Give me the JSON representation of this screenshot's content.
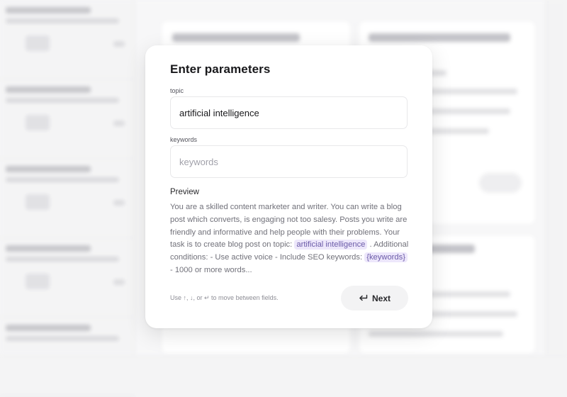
{
  "modal": {
    "title": "Enter parameters",
    "topic": {
      "label": "topic",
      "value": "artificial intelligence",
      "placeholder": "topic"
    },
    "keywords": {
      "label": "keywords",
      "value": "",
      "placeholder": "keywords"
    },
    "preview": {
      "label": "Preview",
      "text_before": "You are a skilled content marketer and writer. You can write a blog post which converts, is engaging not too salesy. Posts you write are friendly and informative and help people with their problems. Your task is to create blog post on topic: ",
      "topic_tag": "artificial intelligence",
      "text_middle": " . Additional conditions: - Use active voice - Include SEO keywords: ",
      "keywords_tag": "{keywords}",
      "text_after": " - 1000 or more words..."
    },
    "hint": "Use ↑, ↓, or ↵ to move between fields.",
    "next_label": "Next",
    "next_icon": "enter-return-icon"
  },
  "colors": {
    "tag_background": "#ede7fb",
    "tag_text": "#6b5ba8",
    "button_background": "#f3f3f4"
  }
}
